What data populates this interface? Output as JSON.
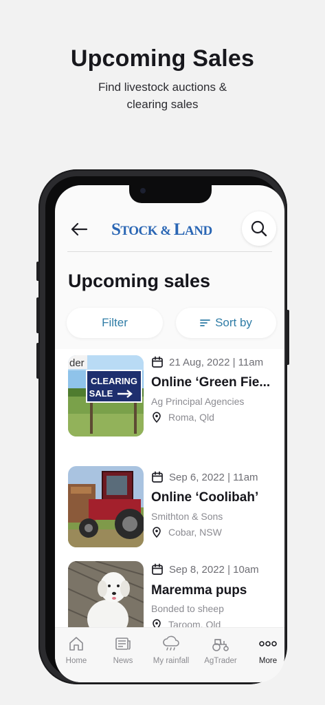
{
  "promo": {
    "title": "Upcoming Sales",
    "subtitle_line1": "Find livestock auctions &",
    "subtitle_line2": "clearing sales"
  },
  "app": {
    "logo_part1": "S",
    "logo_part2": "TOCK",
    "logo_part3": " & ",
    "logo_part4": "L",
    "logo_part5": "AND",
    "brand_color": "#2a66b4",
    "accent_color": "#2f7ca6"
  },
  "page": {
    "title": "Upcoming sales",
    "filter_label": "Filter",
    "sort_label": "Sort by"
  },
  "sales": [
    {
      "date": "21 Aug, 2022 | 11am",
      "title": "Online ‘Green Fie...",
      "agent": "Ag Principal Agencies",
      "location": "Roma, Qld",
      "sign_top": "CLEARING",
      "sign_bottom": "SALE",
      "corner_text": "der"
    },
    {
      "date": "Sep 6, 2022 | 11am",
      "title": "Online ‘Coolibah’",
      "agent": "Smithton & Sons",
      "location": "Cobar, NSW"
    },
    {
      "date": "Sep 8, 2022 | 10am",
      "title": "Maremma pups",
      "agent": "Bonded to sheep",
      "location": "Taroom, Qld"
    }
  ],
  "tabs": [
    {
      "label": "Home",
      "icon": "home-icon"
    },
    {
      "label": "News",
      "icon": "news-icon"
    },
    {
      "label": "My rainfall",
      "icon": "rain-cloud-icon"
    },
    {
      "label": "AgTrader",
      "icon": "tractor-icon"
    },
    {
      "label": "More",
      "icon": "more-dots-icon"
    }
  ]
}
